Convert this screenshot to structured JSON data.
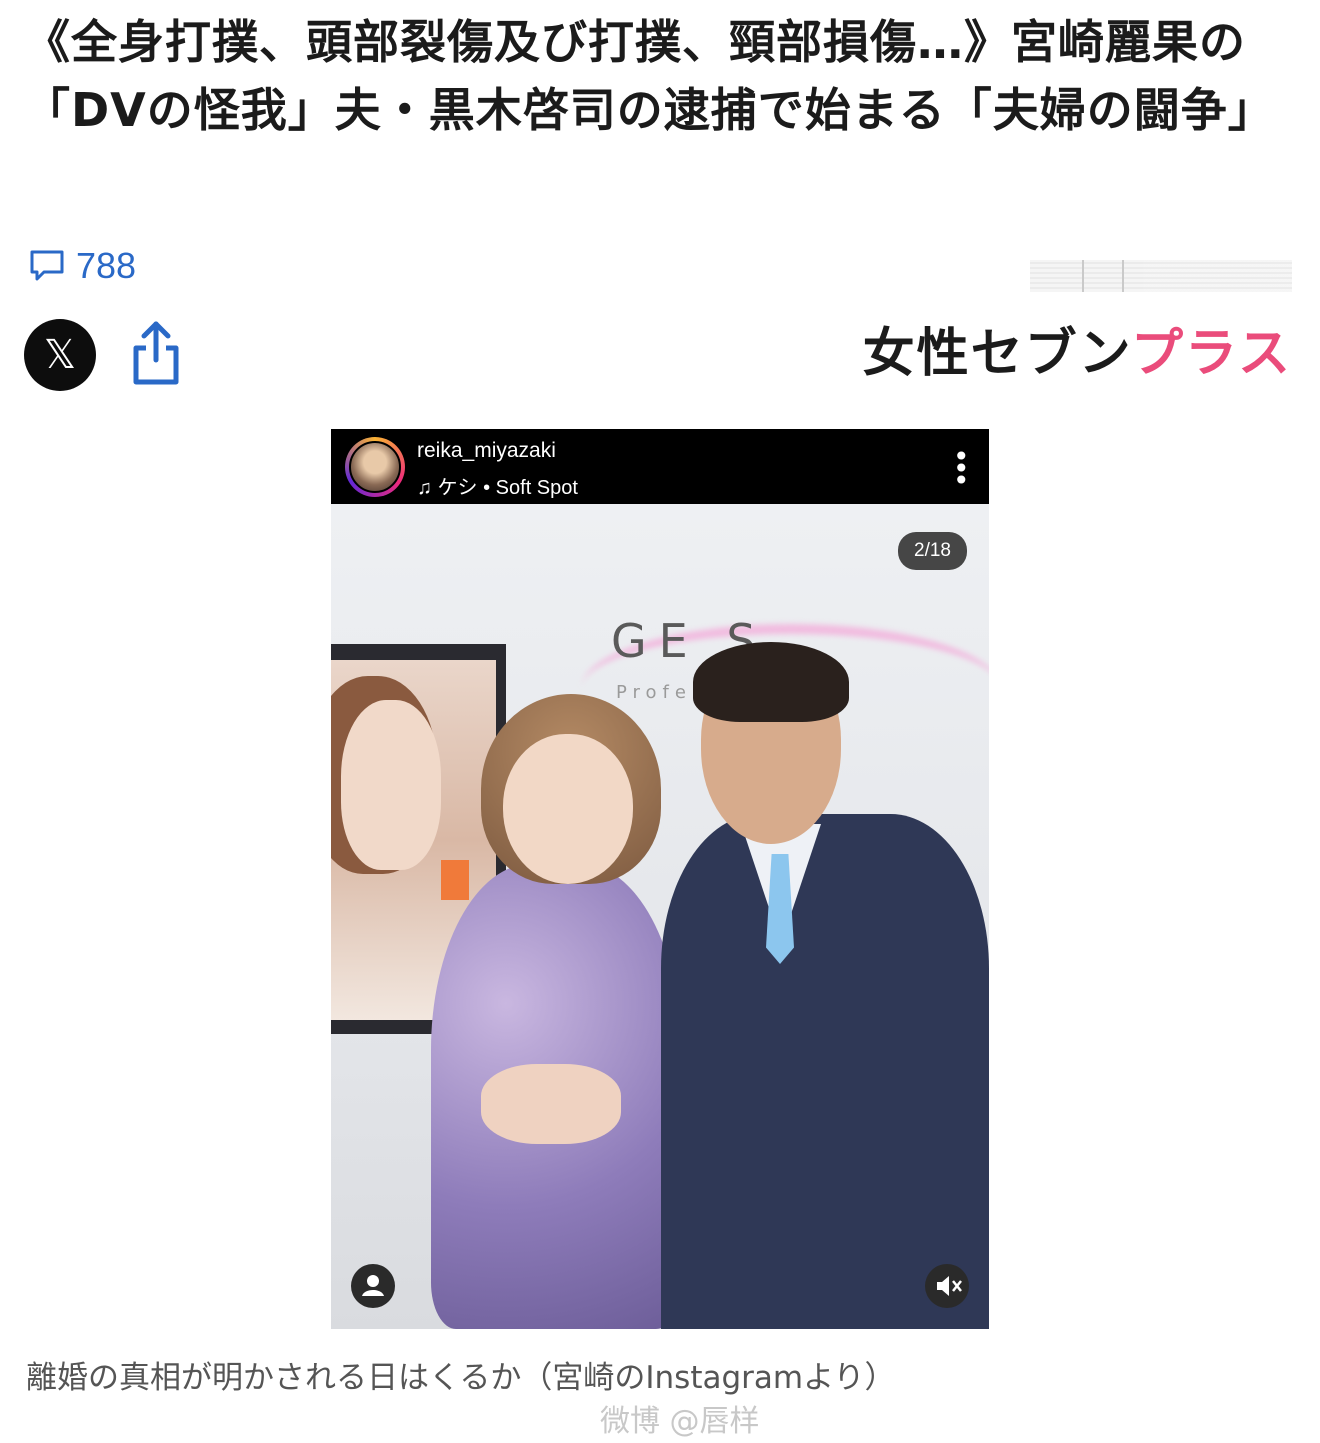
{
  "article": {
    "headline": "《全身打撲、頭部裂傷及び打撲、頸部損傷…》宮崎麗果の「DVの怪我」夫・黒木啓司の逮捕で始まる「夫婦の闘争」",
    "comment_count": "788",
    "source_brand_dark": "女性セブン",
    "source_brand_pink": "プラス",
    "caption": "離婚の真相が明かされる日はくるか（宮崎のInstagramより）"
  },
  "share": {
    "x_label": "𝕏"
  },
  "instagram_post": {
    "username": "reika_miyazaki",
    "music": "♫ ケシ • Soft Spot",
    "counter": "2/18",
    "sign_text": "GE  S",
    "sign_sub": "Profe"
  },
  "watermark": "微博 @唇样",
  "colors": {
    "link_blue": "#2a69c7",
    "brand_pink": "#ea4c7b",
    "text_dark": "#1b1b1b"
  },
  "icons": [
    "comment-icon",
    "x-logo-icon",
    "share-icon",
    "more-vertical-icon",
    "profile-icon",
    "mute-icon",
    "music-note-icon"
  ]
}
